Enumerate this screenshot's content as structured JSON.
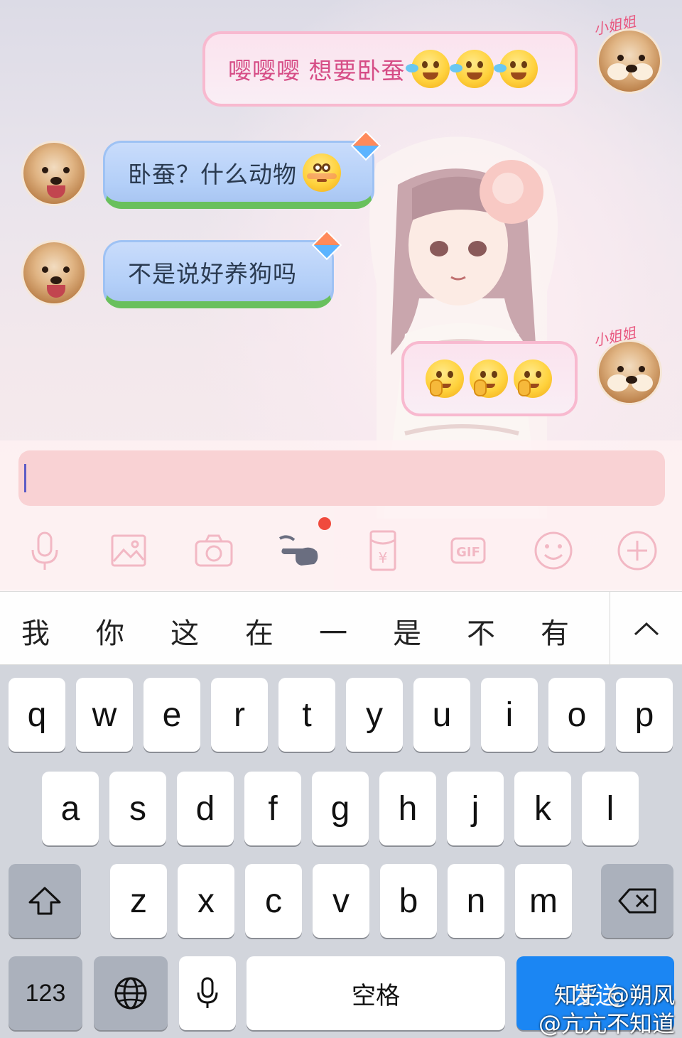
{
  "chat": {
    "messages": [
      {
        "side": "right",
        "text": "嘤嘤嘤 想要卧蚕",
        "emojis": [
          "cry-laugh",
          "cry-laugh",
          "cry-laugh"
        ],
        "sender_tag": "小姐姐"
      },
      {
        "side": "left",
        "text": "卧蚕？什么动物",
        "emojis": [
          "flushed"
        ]
      },
      {
        "side": "left",
        "text": "不是说好养狗吗",
        "emojis": []
      },
      {
        "side": "right",
        "text": "",
        "emojis": [
          "shy",
          "shy",
          "shy"
        ],
        "sender_tag": "小姐姐"
      }
    ]
  },
  "input": {
    "value": ""
  },
  "toolbar": {
    "icons": [
      "microphone-icon",
      "image-icon",
      "camera-icon",
      "poke-icon",
      "red-packet-icon",
      "gif-icon",
      "emoji-icon",
      "plus-icon"
    ],
    "gif_label": "GIF",
    "red_packet_label": "¥",
    "badge_color": "#f04a3d"
  },
  "candidates": {
    "items": [
      "我",
      "你",
      "这",
      "在",
      "一",
      "是",
      "不",
      "有"
    ]
  },
  "keyboard": {
    "row1": [
      "q",
      "w",
      "e",
      "r",
      "t",
      "y",
      "u",
      "i",
      "o",
      "p"
    ],
    "row2": [
      "a",
      "s",
      "d",
      "f",
      "g",
      "h",
      "j",
      "k",
      "l"
    ],
    "row3": [
      "z",
      "x",
      "c",
      "v",
      "b",
      "n",
      "m"
    ],
    "numbers_label": "123",
    "space_label": "空格",
    "send_label": "发送",
    "send_color": "#1b86f3"
  },
  "watermark": {
    "line1": "知乎 @朔风",
    "line2": "@亢亢不知道"
  }
}
